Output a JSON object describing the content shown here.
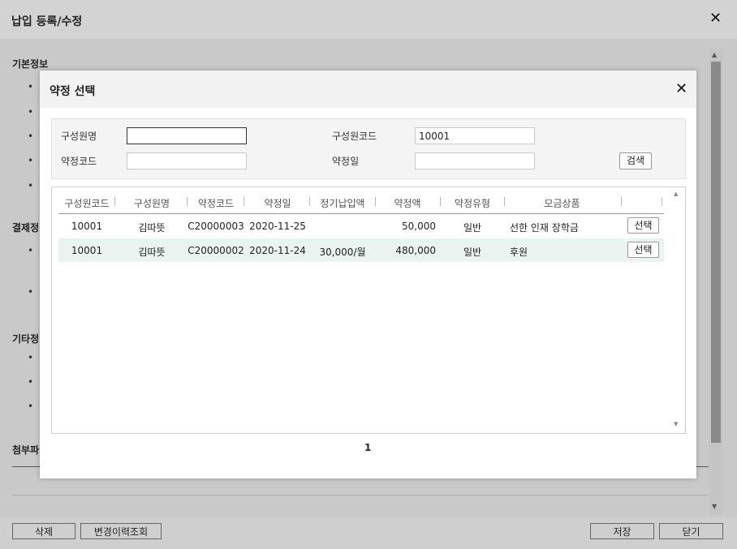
{
  "outer": {
    "title": "납입 등록/수정",
    "sections": {
      "basic": "기본정보",
      "payment": "결제정",
      "other": "기타정",
      "attach": "첨부파"
    },
    "bullet": "•",
    "buttons": {
      "delete": "삭제",
      "history": "변경이력조회",
      "save": "저장",
      "close": "닫기"
    }
  },
  "modal": {
    "title": "약정 선택",
    "search": {
      "member_name_label": "구성원명",
      "member_name_value": "",
      "member_code_label": "구성원코드",
      "member_code_value": "10001",
      "pledge_code_label": "약정코드",
      "pledge_code_value": "",
      "pledge_date_label": "약정일",
      "pledge_date_value": "",
      "search_button": "검색"
    },
    "grid": {
      "columns": [
        "구성원코드",
        "구성원명",
        "약정코드",
        "약정일",
        "정기납입액",
        "약정액",
        "약정유형",
        "모금상품",
        ""
      ],
      "rows": [
        {
          "member_code": "10001",
          "member_name": "김따뜻",
          "pledge_code": "C20000003",
          "pledge_date": "2020-11-25",
          "regular": "",
          "amount": "50,000",
          "type": "일반",
          "product": "선한 인재 장학금",
          "action": "선택"
        },
        {
          "member_code": "10001",
          "member_name": "김따뜻",
          "pledge_code": "C20000002",
          "pledge_date": "2020-11-24",
          "regular": "30,000/월",
          "amount": "480,000",
          "type": "일반",
          "product": "후원",
          "action": "선택"
        }
      ]
    },
    "page": "1"
  }
}
